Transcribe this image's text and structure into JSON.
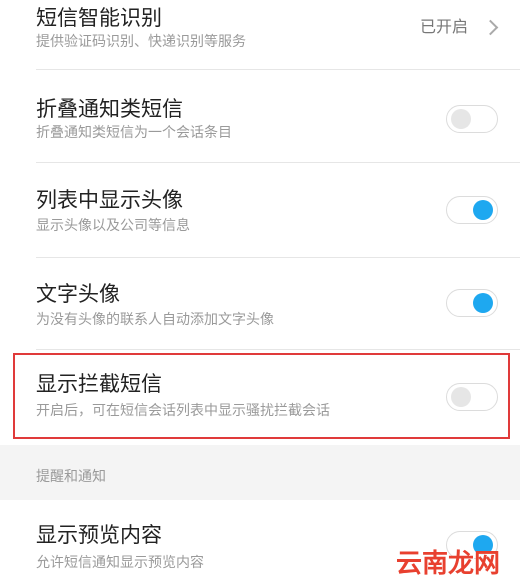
{
  "settings": {
    "smart_recognition": {
      "title": "短信智能识别",
      "subtitle": "提供验证码识别、快递识别等服务",
      "status": "已开启"
    },
    "fold_notifications": {
      "title": "折叠通知类短信",
      "subtitle": "折叠通知类短信为一个会话条目",
      "enabled": false
    },
    "show_avatar": {
      "title": "列表中显示头像",
      "subtitle": "显示头像以及公司等信息",
      "enabled": true
    },
    "text_avatar": {
      "title": "文字头像",
      "subtitle": "为没有头像的联系人自动添加文字头像",
      "enabled": true
    },
    "show_blocked": {
      "title": "显示拦截短信",
      "subtitle": "开启后，可在短信会话列表中显示骚扰拦截会话",
      "enabled": false
    }
  },
  "section_header": "提醒和通知",
  "notifications": {
    "preview": {
      "title": "显示预览内容",
      "subtitle": "允许短信通知显示预览内容",
      "enabled": true
    }
  },
  "watermark": "云南龙网",
  "colors": {
    "accent": "#1ea8f0",
    "highlight_border": "#e03a3a",
    "watermark": "#e8402f"
  }
}
